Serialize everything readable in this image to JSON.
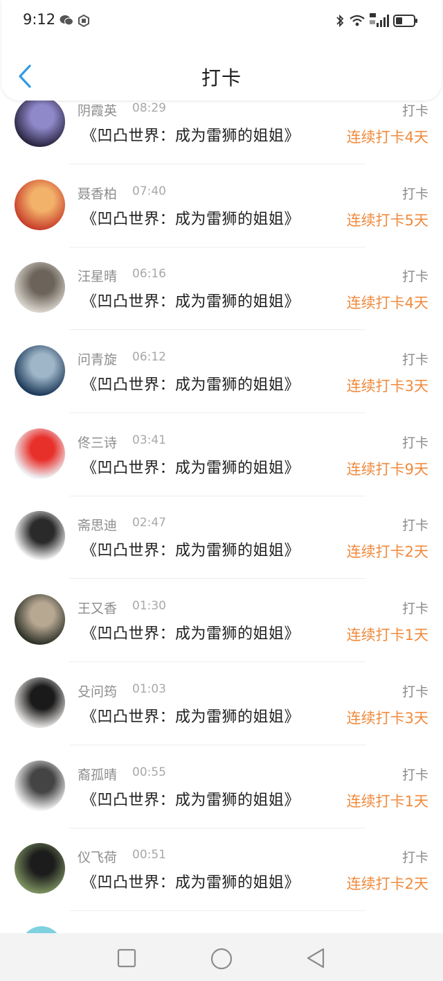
{
  "status_bar": {
    "time": "9:12"
  },
  "header": {
    "title": "打卡"
  },
  "items": [
    {
      "name": "阴霞英",
      "time": "08:29",
      "tag": "打卡",
      "book": "《凹凸世界：成为雷狮的姐姐》",
      "streak": "连续打卡4天",
      "avatar_colors": [
        "#2b2743",
        "#8f88c9"
      ]
    },
    {
      "name": "聂香柏",
      "time": "07:40",
      "tag": "打卡",
      "book": "《凹凸世界：成为雷狮的姐姐》",
      "streak": "连续打卡5天",
      "avatar_colors": [
        "#c8402c",
        "#f3b26a"
      ]
    },
    {
      "name": "汪星晴",
      "time": "06:16",
      "tag": "打卡",
      "book": "《凹凸世界：成为雷狮的姐姐》",
      "streak": "连续打卡4天",
      "avatar_colors": [
        "#d7d3cb",
        "#6c645a"
      ]
    },
    {
      "name": "问青旋",
      "time": "06:12",
      "tag": "打卡",
      "book": "《凹凸世界：成为雷狮的姐姐》",
      "streak": "连续打卡3天",
      "avatar_colors": [
        "#1d3b5a",
        "#9fb6c8"
      ]
    },
    {
      "name": "佟三诗",
      "time": "03:41",
      "tag": "打卡",
      "book": "《凹凸世界：成为雷狮的姐姐》",
      "streak": "连续打卡9天",
      "avatar_colors": [
        "#eef3f8",
        "#e8302a"
      ]
    },
    {
      "name": "斋思迪",
      "time": "02:47",
      "tag": "打卡",
      "book": "《凹凸世界：成为雷狮的姐姐》",
      "streak": "连续打卡2天",
      "avatar_colors": [
        "#ffffff",
        "#2a2a2a"
      ]
    },
    {
      "name": "王又香",
      "time": "01:30",
      "tag": "打卡",
      "book": "《凹凸世界：成为雷狮的姐姐》",
      "streak": "连续打卡1天",
      "avatar_colors": [
        "#2f3329",
        "#b7a892"
      ]
    },
    {
      "name": "殳问筠",
      "time": "01:03",
      "tag": "打卡",
      "book": "《凹凸世界：成为雷狮的姐姐》",
      "streak": "连续打卡3天",
      "avatar_colors": [
        "#e3e1df",
        "#1a1a1a"
      ]
    },
    {
      "name": "裔孤晴",
      "time": "00:55",
      "tag": "打卡",
      "book": "《凹凸世界：成为雷狮的姐姐》",
      "streak": "连续打卡1天",
      "avatar_colors": [
        "#f4f4f4",
        "#444444"
      ]
    },
    {
      "name": "仪飞荷",
      "time": "00:51",
      "tag": "打卡",
      "book": "《凹凸世界：成为雷狮的姐姐》",
      "streak": "连续打卡2天",
      "avatar_colors": [
        "#7a8f5f",
        "#1c1c1c"
      ]
    }
  ],
  "colors": {
    "accent": "#2f9be5",
    "streak": "#f08a3c"
  }
}
